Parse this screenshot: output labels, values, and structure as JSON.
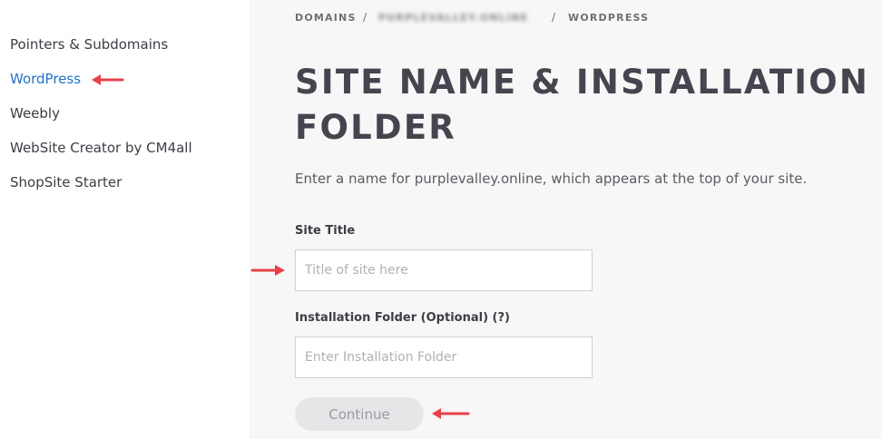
{
  "sidebar": {
    "items": [
      {
        "label": "Pointers & Subdomains"
      },
      {
        "label": "WordPress"
      },
      {
        "label": "Weebly"
      },
      {
        "label": "WebSite Creator by CM4all"
      },
      {
        "label": "ShopSite Starter"
      }
    ]
  },
  "breadcrumb": {
    "items": [
      "DOMAINS",
      "PURPLEVALLEY.ONLINE",
      "WORDPRESS"
    ],
    "separator": "/"
  },
  "page": {
    "title": "SITE NAME & INSTALLATION FOLDER",
    "description": "Enter a name for purplevalley.online, which appears at the top of your site."
  },
  "form": {
    "site_title_label": "Site Title",
    "site_title_placeholder": "Title of site here",
    "folder_label": "Installation Folder (Optional) (?)",
    "folder_placeholder": "Enter Installation Folder",
    "continue_label": "Continue"
  },
  "colors": {
    "accent": "#1f73c9",
    "annotation_arrow": "#e8414a"
  }
}
